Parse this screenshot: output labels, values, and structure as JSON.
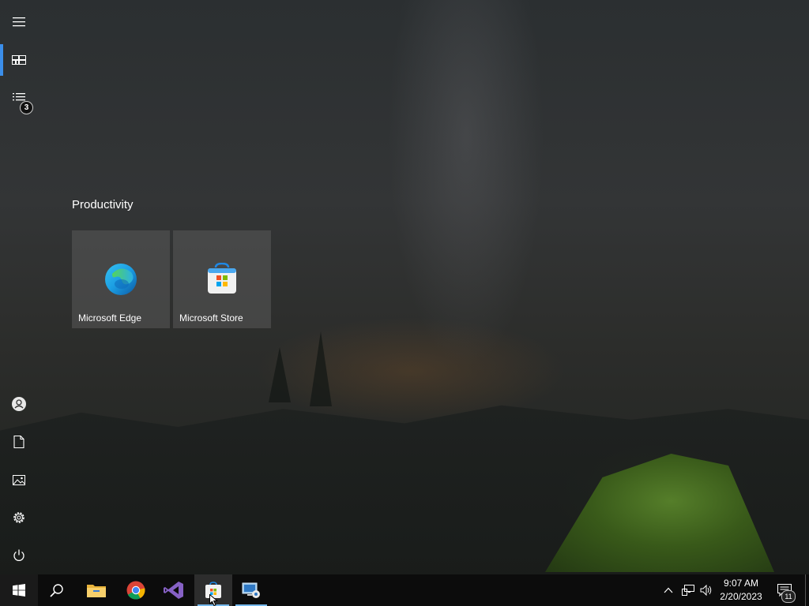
{
  "start_menu": {
    "rail": {
      "expand_icon": "hamburger-icon",
      "tiles_icon": "all-tiles-icon",
      "all_apps_icon": "all-apps-list-icon",
      "all_apps_badge": "3",
      "user_icon": "user-account-icon",
      "documents_icon": "documents-icon",
      "pictures_icon": "pictures-icon",
      "settings_icon": "settings-gear-icon",
      "power_icon": "power-icon"
    },
    "group": {
      "title": "Productivity",
      "tiles": [
        {
          "label": "Microsoft Edge",
          "icon": "edge-logo-icon"
        },
        {
          "label": "Microsoft Store",
          "icon": "store-bag-icon"
        }
      ]
    }
  },
  "taskbar": {
    "apps": [
      {
        "name": "Start",
        "icon": "windows-logo-icon"
      },
      {
        "name": "Search",
        "icon": "search-icon"
      },
      {
        "name": "File Explorer",
        "icon": "folder-icon"
      },
      {
        "name": "Google Chrome",
        "icon": "chrome-icon"
      },
      {
        "name": "Visual Studio",
        "icon": "visual-studio-icon"
      },
      {
        "name": "Microsoft Store",
        "icon": "store-bag-icon"
      },
      {
        "name": "Remote Desktop",
        "icon": "remote-desktop-icon"
      }
    ],
    "tray": {
      "time": "9:07 AM",
      "date": "2/20/2023",
      "notification_count": "11"
    }
  },
  "colors": {
    "accent": "#3b8eea",
    "taskbar": "#0c0c0c",
    "tile": "#5a5a5a"
  }
}
